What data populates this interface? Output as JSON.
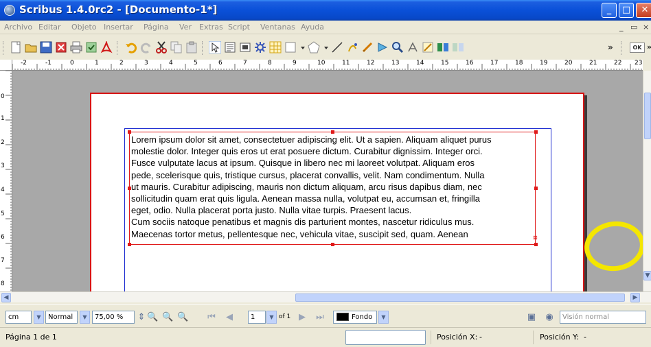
{
  "window": {
    "title": "Scribus 1.4.0rc2 - [Documento-1*]"
  },
  "menu": [
    "Archivo",
    "Editar",
    "Objeto",
    "Insertar",
    "Página",
    "Ver",
    "Extras",
    "Script",
    "Ventanas",
    "Ayuda"
  ],
  "toolbar": {
    "ok_label": "OK",
    "more_label": "»"
  },
  "ruler": {
    "h_labels": [
      "-2",
      "-1",
      "0",
      "1",
      "2",
      "3",
      "4",
      "5",
      "6",
      "7",
      "8",
      "9",
      "10",
      "11",
      "12",
      "13",
      "14",
      "15",
      "16",
      "17",
      "18",
      "19",
      "20",
      "21",
      "22",
      "23"
    ],
    "v_labels": [
      "0",
      "1",
      "2",
      "3",
      "4",
      "5",
      "6",
      "7",
      "8"
    ]
  },
  "document": {
    "text_lines": [
      "Lorem ipsum dolor sit amet, consectetuer adipiscing elit. Ut a sapien. Aliquam aliquet purus",
      "molestie dolor. Integer quis eros ut erat posuere dictum. Curabitur dignissim. Integer orci.",
      "Fusce vulputate lacus at ipsum. Quisque in libero nec mi laoreet volutpat. Aliquam eros",
      "pede, scelerisque quis, tristique cursus, placerat convallis, velit. Nam condimentum. Nulla",
      "ut mauris. Curabitur adipiscing, mauris non dictum aliquam, arcu risus dapibus diam, nec",
      "sollicitudin quam erat quis ligula. Aenean massa nulla, volutpat eu, accumsan et, fringilla",
      "eget, odio. Nulla placerat porta justo. Nulla vitae turpis. Praesent lacus.",
      "Cum sociis natoque penatibus et magnis dis parturient montes, nascetur ridiculus mus.",
      "Maecenas tortor metus, pellentesque nec, vehicula vitae, suscipit sed, quam. Aenean"
    ]
  },
  "controls": {
    "unit": "cm",
    "mode": "Normal",
    "zoom": "75,00 %",
    "page_number": "1",
    "page_of": "of 1",
    "layer": "Fondo",
    "view_mode": "Visión normal"
  },
  "status": {
    "page_label": "Página 1 de 1",
    "pos_x_label": "Posición X:",
    "pos_x_value": "-",
    "pos_y_label": "Posición Y:",
    "pos_y_value": "-"
  },
  "colors": {
    "titlebar": "#0A50D8",
    "frame_red": "#E01A1A",
    "margin_blue": "#1A2AD0",
    "highlight_yellow": "#F4E600"
  }
}
